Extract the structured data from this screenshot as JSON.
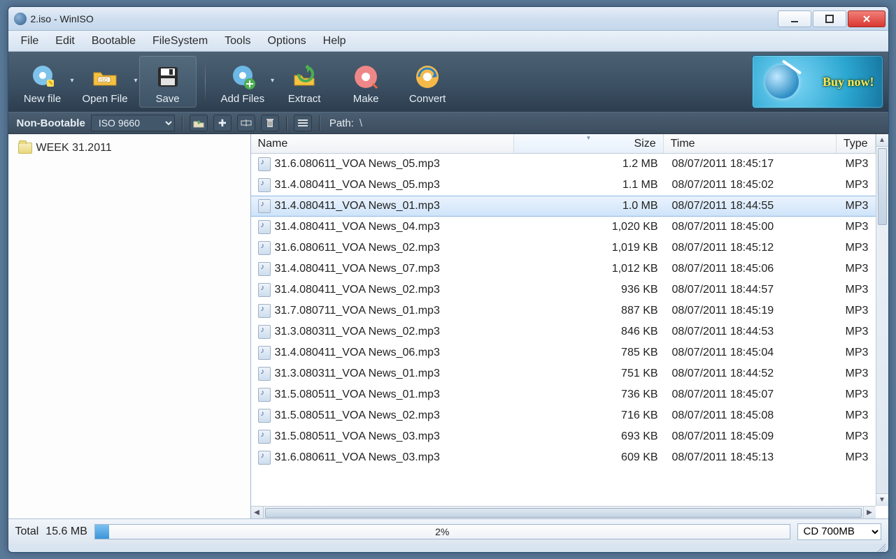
{
  "title": "2.iso - WinISO",
  "menu": [
    "File",
    "Edit",
    "Bootable",
    "FileSystem",
    "Tools",
    "Options",
    "Help"
  ],
  "toolbar": {
    "newFile": "New file",
    "openFile": "Open File",
    "save": "Save",
    "addFiles": "Add Files",
    "extract": "Extract",
    "make": "Make",
    "convert": "Convert",
    "buy": "Buy now!"
  },
  "subbar": {
    "bootLabel": "Non-Bootable",
    "fs": "ISO 9660",
    "pathLabel": "Path:",
    "pathValue": "\\"
  },
  "tree": {
    "root": "WEEK 31.2011"
  },
  "columns": {
    "name": "Name",
    "size": "Size",
    "time": "Time",
    "type": "Type"
  },
  "files": [
    {
      "name": "31.6.080611_VOA News_05.mp3",
      "size": "1.2 MB",
      "time": "08/07/2011 18:45:17",
      "type": "MP3"
    },
    {
      "name": "31.4.080411_VOA News_05.mp3",
      "size": "1.1 MB",
      "time": "08/07/2011 18:45:02",
      "type": "MP3"
    },
    {
      "name": "31.4.080411_VOA News_01.mp3",
      "size": "1.0 MB",
      "time": "08/07/2011 18:44:55",
      "type": "MP3",
      "selected": true
    },
    {
      "name": "31.4.080411_VOA News_04.mp3",
      "size": "1,020 KB",
      "time": "08/07/2011 18:45:00",
      "type": "MP3"
    },
    {
      "name": "31.6.080611_VOA News_02.mp3",
      "size": "1,019 KB",
      "time": "08/07/2011 18:45:12",
      "type": "MP3"
    },
    {
      "name": "31.4.080411_VOA News_07.mp3",
      "size": "1,012 KB",
      "time": "08/07/2011 18:45:06",
      "type": "MP3"
    },
    {
      "name": "31.4.080411_VOA News_02.mp3",
      "size": "936 KB",
      "time": "08/07/2011 18:44:57",
      "type": "MP3"
    },
    {
      "name": "31.7.080711_VOA News_01.mp3",
      "size": "887 KB",
      "time": "08/07/2011 18:45:19",
      "type": "MP3"
    },
    {
      "name": "31.3.080311_VOA News_02.mp3",
      "size": "846 KB",
      "time": "08/07/2011 18:44:53",
      "type": "MP3"
    },
    {
      "name": "31.4.080411_VOA News_06.mp3",
      "size": "785 KB",
      "time": "08/07/2011 18:45:04",
      "type": "MP3"
    },
    {
      "name": "31.3.080311_VOA News_01.mp3",
      "size": "751 KB",
      "time": "08/07/2011 18:44:52",
      "type": "MP3"
    },
    {
      "name": "31.5.080511_VOA News_01.mp3",
      "size": "736 KB",
      "time": "08/07/2011 18:45:07",
      "type": "MP3"
    },
    {
      "name": "31.5.080511_VOA News_02.mp3",
      "size": "716 KB",
      "time": "08/07/2011 18:45:08",
      "type": "MP3"
    },
    {
      "name": "31.5.080511_VOA News_03.mp3",
      "size": "693 KB",
      "time": "08/07/2011 18:45:09",
      "type": "MP3"
    },
    {
      "name": "31.6.080611_VOA News_03.mp3",
      "size": "609 KB",
      "time": "08/07/2011 18:45:13",
      "type": "MP3"
    }
  ],
  "status": {
    "totalLabel": "Total",
    "totalValue": "15.6 MB",
    "percent": "2%",
    "medium": "CD 700MB"
  }
}
